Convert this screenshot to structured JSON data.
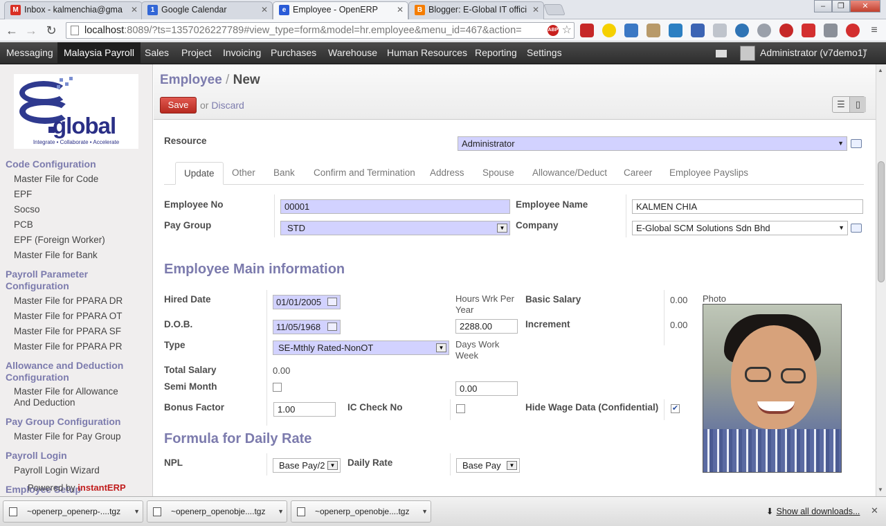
{
  "browser": {
    "tabs": [
      {
        "title": "Inbox - kalmenchia@gma",
        "favicon": "gmail-icon",
        "color": "#d93025"
      },
      {
        "title": "Google Calendar",
        "favicon": "calendar-icon",
        "color": "#3367d6"
      },
      {
        "title": "Employee - OpenERP",
        "favicon": "openerp-icon",
        "color": "#2a5bd7"
      },
      {
        "title": "Blogger: E-Global IT offici",
        "favicon": "blogger-icon",
        "color": "#f57d00"
      }
    ],
    "url_host": "localhost",
    "url_rest": ":8089/?ts=1357026227789#view_type=form&model=hr.employee&menu_id=467&action=",
    "abp_label": "ABP"
  },
  "topmenu": {
    "items": [
      "Messaging",
      "Malaysia Payroll",
      "Sales",
      "Project",
      "Invoicing",
      "Purchases",
      "Warehouse",
      "Human Resources",
      "Reporting",
      "Settings"
    ],
    "active_index": 1,
    "user": "Administrator (v7demo1)"
  },
  "logo": {
    "word": "global",
    "tagline": "Integrate • Collaborate • Accelerate"
  },
  "sidebar": {
    "groups": [
      {
        "header": "Code Configuration",
        "items": [
          "Master File for Code",
          "EPF",
          "Socso",
          "PCB",
          "EPF (Foreign Worker)",
          "Master File for Bank"
        ]
      },
      {
        "header": "Payroll Parameter Configuration",
        "items": [
          "Master File for PPARA DR",
          "Master File for PPARA OT",
          "Master File for PPARA SF",
          "Master File for PPARA PR"
        ]
      },
      {
        "header": "Allowance and Deduction Configuration",
        "items": [
          "Master File for Allowance And Deduction"
        ]
      },
      {
        "header": "Pay Group Configuration",
        "items": [
          "Master File for Pay Group"
        ]
      },
      {
        "header": "Payroll Login",
        "items": [
          "Payroll Login Wizard"
        ]
      },
      {
        "header": "Employee Setup",
        "items": []
      }
    ],
    "powered_prefix": "Powered by",
    "powered_brand": "instantERP"
  },
  "header": {
    "breadcrumb_parent": "Employee",
    "breadcrumb_sep": "/",
    "breadcrumb_current": "New",
    "save_label": "Save",
    "or_label": "or",
    "discard_label": "Discard"
  },
  "form": {
    "resource_label": "Resource",
    "resource_value": "Administrator",
    "tabs": [
      "Update",
      "Other",
      "Bank",
      "Confirm and Termination",
      "Address",
      "Spouse",
      "Allowance/Deduct",
      "Career",
      "Employee Payslips"
    ],
    "active_tab": 0,
    "employee_no_label": "Employee No",
    "employee_no": "00001",
    "employee_name_label": "Employee Name",
    "employee_name": "KALMEN CHIA",
    "pay_group_label": "Pay Group",
    "pay_group": "STD",
    "company_label": "Company",
    "company": "E-Global SCM Solutions Sdn Bhd",
    "section_main": "Employee Main information",
    "hired_date_label": "Hired Date",
    "hired_date": "01/01/2005",
    "dob_label": "D.O.B.",
    "dob": "11/05/1968",
    "type_label": "Type",
    "type_value": "SE-Mthly Rated-NonOT",
    "total_salary_label": "Total Salary",
    "total_salary": "0.00",
    "semi_month_label": "Semi Month",
    "bonus_factor_label": "Bonus Factor",
    "bonus_factor": "1.00",
    "hours_label": "Hours Wrk Per Year",
    "hours_value": "2288.00",
    "days_label": "Days Work Week",
    "days_value": "0.00",
    "ic_check_label": "IC Check No",
    "basic_salary_label": "Basic Salary",
    "basic_salary": "0.00",
    "increment_label": "Increment",
    "increment": "0.00",
    "hide_wage_label": "Hide Wage Data (Confidential)",
    "photo_label": "Photo",
    "section_formula": "Formula for Daily Rate",
    "npl_label": "NPL",
    "npl_value": "Base Pay/2",
    "daily_rate_label": "Daily Rate",
    "daily_rate_value": "Base Pay"
  },
  "downloads": {
    "files": [
      "~openerp_openerp-....tgz",
      "~openerp_openobje....tgz",
      "~openerp_openobje....tgz"
    ],
    "show_all": "Show all downloads..."
  }
}
